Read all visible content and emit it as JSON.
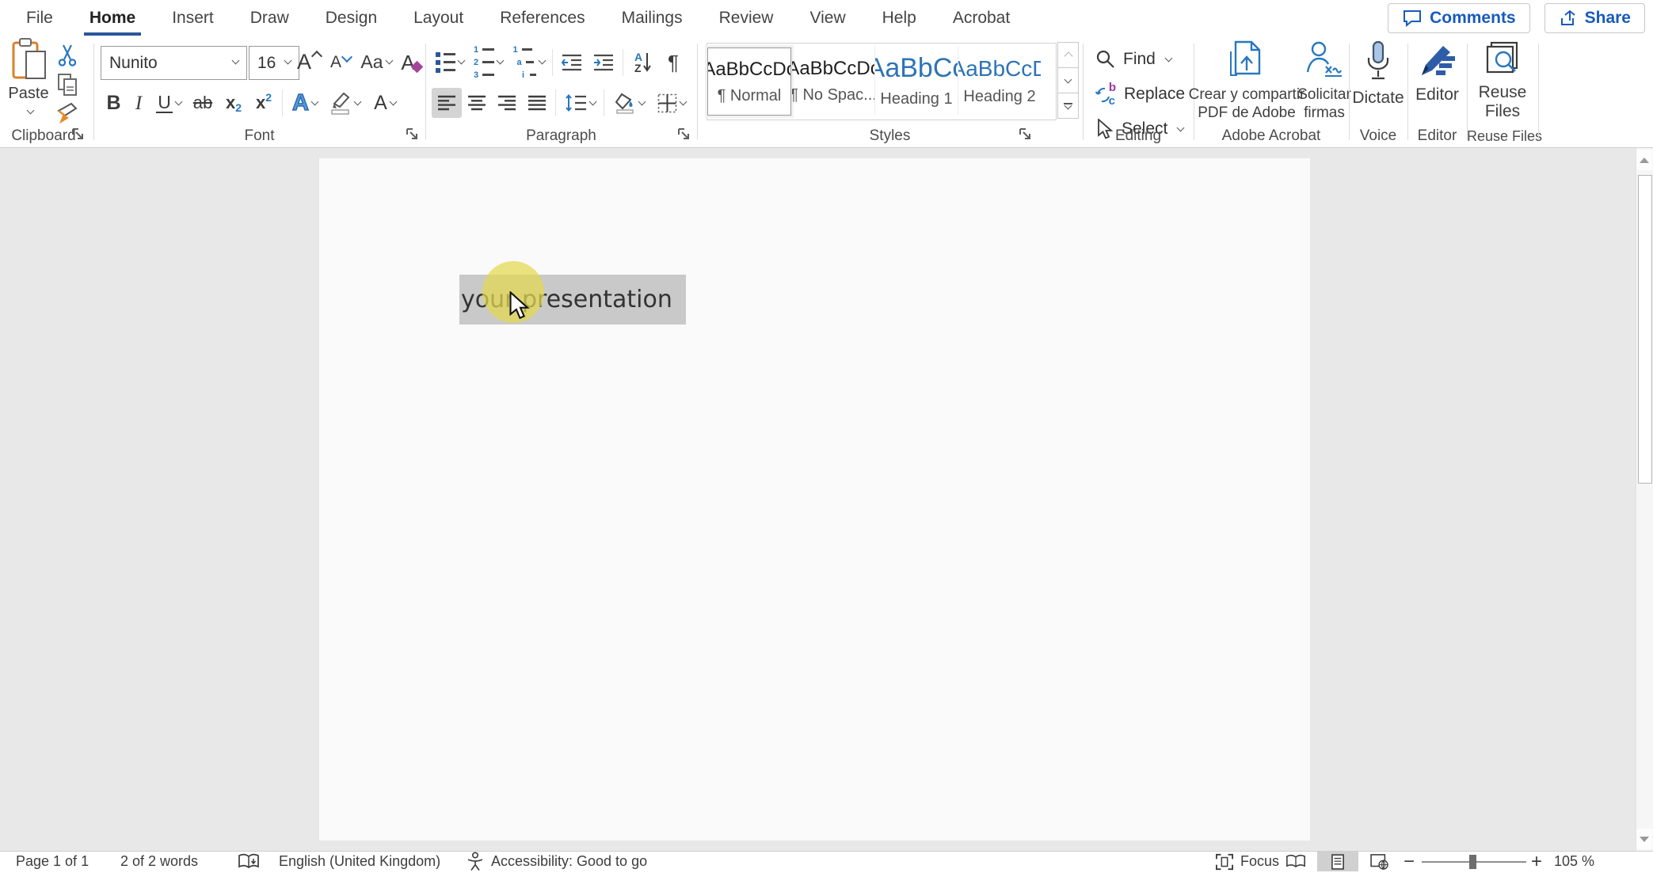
{
  "menu": {
    "tabs": [
      "File",
      "Home",
      "Insert",
      "Draw",
      "Design",
      "Layout",
      "References",
      "Mailings",
      "Review",
      "View",
      "Help",
      "Acrobat"
    ],
    "active_tab": "Home",
    "comments_label": "Comments",
    "share_label": "Share"
  },
  "ribbon": {
    "clipboard": {
      "label": "Clipboard",
      "paste": "Paste"
    },
    "font": {
      "label": "Font",
      "name": "Nunito",
      "size": "16",
      "bold": "B",
      "italic": "I",
      "underline": "U",
      "strike": "ab",
      "sub_base": "x",
      "sub_mark": "2",
      "sup_base": "x",
      "sup_mark": "2",
      "effects": "A",
      "grow": "A",
      "shrink": "A",
      "case": "Aa",
      "clear": "A",
      "color": "A"
    },
    "paragraph": {
      "label": "Paragraph",
      "pilcrow": "¶",
      "sort_a": "A",
      "sort_z": "Z",
      "num": [
        "1",
        "2",
        "3"
      ],
      "multi": [
        "1",
        "a",
        "i"
      ]
    },
    "styles": {
      "label": "Styles",
      "items": [
        {
          "preview": "AaBbCcDc",
          "name": "¶ Normal",
          "selected": true
        },
        {
          "preview": "AaBbCcDc",
          "name": "¶ No Spac...",
          "selected": false
        },
        {
          "preview": "AaBbCc",
          "name": "Heading 1",
          "selected": false
        },
        {
          "preview": "AaBbCcD",
          "name": "Heading 2",
          "selected": false
        }
      ]
    },
    "editing": {
      "label": "Editing",
      "find": "Find",
      "replace": "Replace",
      "select": "Select",
      "replace_b": "b",
      "replace_c": "c"
    },
    "acrobat": {
      "label": "Adobe Acrobat",
      "create_line1": "Crear y compartir",
      "create_line2": "PDF de Adobe",
      "sign_line1": "Solicitar",
      "sign_line2": "firmas"
    },
    "voice": {
      "label": "Voice",
      "dictate": "Dictate"
    },
    "editor_group": {
      "label": "Editor",
      "editor": "Editor"
    },
    "reuse": {
      "label": "Reuse Files",
      "line1": "Reuse",
      "line2": "Files"
    }
  },
  "document": {
    "selected_text": "your presentation"
  },
  "statusbar": {
    "page": "Page 1 of 1",
    "words": "2 of 2 words",
    "language": "English (United Kingdom)",
    "accessibility": "Accessibility: Good to go",
    "focus": "Focus",
    "zoom_out": "−",
    "zoom_in": "+",
    "zoom_level": "105 %"
  },
  "colors": {
    "accent_blue": "#185abd",
    "icon_blue": "#2878be",
    "tab_underline": "#2b579a",
    "heading_blue": "#2e74b5",
    "selection_gray": "#c9c9c9",
    "click_indicator_yellow": "#e3d84f",
    "canvas_gray": "#e8e8e8"
  }
}
